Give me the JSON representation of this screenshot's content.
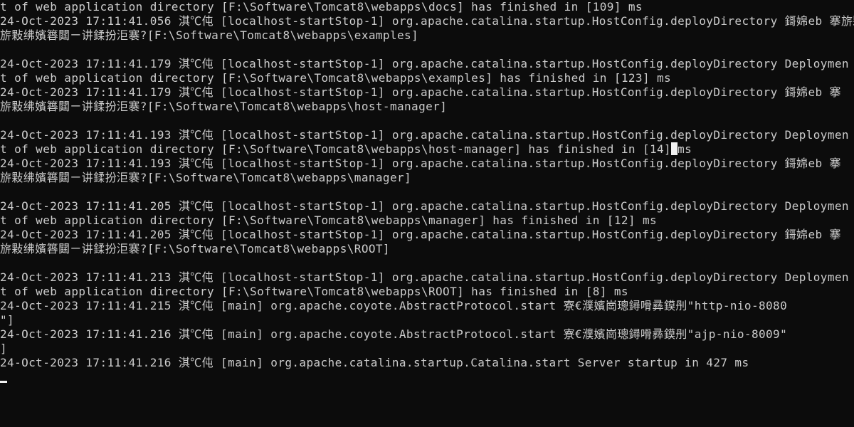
{
  "colors": {
    "background": "#0c0c0c",
    "text": "#cccccc",
    "cursor": "#f2f2f2"
  },
  "log_lines": [
    "t of web application directory [F:\\Software\\Tomcat8\\webapps\\docs] has finished in [109] ms",
    "24-Oct-2023 17:11:41.056 淇℃伅 [localhost-startStop-1] org.apache.catalina.startup.HostConfig.deployDirectory 鎶婂eb 搴旂敤绋嬪簭閮ㄧ讲鍒扮洰褰?[F:\\Software\\Tomcat8\\webapps\\examples]",
    "旂敤绋嬪簭閮ㄧ讲鍒扮洰褰?[F:\\Software\\Tomcat8\\webapps\\examples]",
    "",
    "24-Oct-2023 17:11:41.179 淇℃伅 [localhost-startStop-1] org.apache.catalina.startup.HostConfig.deployDirectory Deploymen",
    "t of web application directory [F:\\Software\\Tomcat8\\webapps\\examples] has finished in [123] ms",
    "24-Oct-2023 17:11:41.179 淇℃伅 [localhost-startStop-1] org.apache.catalina.startup.HostConfig.deployDirectory 鎶婂eb 搴",
    "旂敤绋嬪簭閮ㄧ讲鍒扮洰褰?[F:\\Software\\Tomcat8\\webapps\\host-manager]",
    "",
    "24-Oct-2023 17:11:41.193 淇℃伅 [localhost-startStop-1] org.apache.catalina.startup.HostConfig.deployDirectory Deploymen",
    "t of web application directory [F:\\Software\\Tomcat8\\webapps\\host-manager] has finished in [14]",
    "24-Oct-2023 17:11:41.193 淇℃伅 [localhost-startStop-1] org.apache.catalina.startup.HostConfig.deployDirectory 鎶婂eb 搴",
    "旂敤绋嬪簭閮ㄧ讲鍒扮洰褰?[F:\\Software\\Tomcat8\\webapps\\manager]",
    "",
    "24-Oct-2023 17:11:41.205 淇℃伅 [localhost-startStop-1] org.apache.catalina.startup.HostConfig.deployDirectory Deploymen",
    "t of web application directory [F:\\Software\\Tomcat8\\webapps\\manager] has finished in [12] ms",
    "24-Oct-2023 17:11:41.205 淇℃伅 [localhost-startStop-1] org.apache.catalina.startup.HostConfig.deployDirectory 鎶婂eb 搴",
    "旂敤绋嬪簭閮ㄧ讲鍒扮洰褰?[F:\\Software\\Tomcat8\\webapps\\ROOT]",
    "",
    "24-Oct-2023 17:11:41.213 淇℃伅 [localhost-startStop-1] org.apache.catalina.startup.HostConfig.deployDirectory Deploymen",
    "t of web application directory [F:\\Software\\Tomcat8\\webapps\\ROOT] has finished in [8] ms",
    "24-Oct-2023 17:11:41.215 淇℃伅 [main] org.apache.coyote.AbstractProtocol.start 寮€濮嬪崗璁鐞嗗彞鏌刐\"http-nio-8080",
    "\"]",
    "24-Oct-2023 17:11:41.216 淇℃伅 [main] org.apache.coyote.AbstractProtocol.start 寮€濮嬪崗璁鐞嗗彞鏌刐\"ajp-nio-8009\"",
    "]",
    "24-Oct-2023 17:11:41.216 淇℃伅 [main] org.apache.catalina.startup.Catalina.start Server startup in 427 ms"
  ],
  "inline_cursor_suffix": "ms"
}
